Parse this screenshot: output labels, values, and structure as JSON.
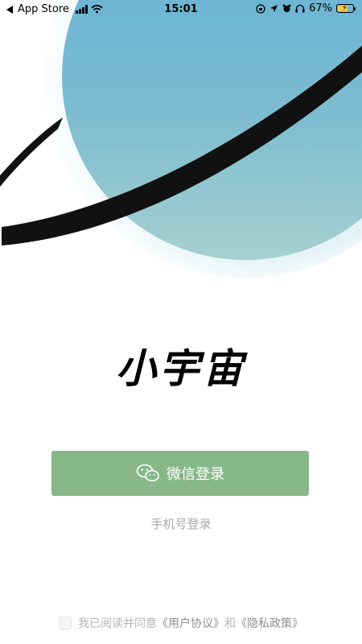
{
  "status_bar": {
    "back_app": "App Store",
    "time": "15:01",
    "battery_percent": "67%",
    "battery_level": 0.67,
    "icons": [
      "signal-icon",
      "wifi-icon",
      "screen-lock-icon",
      "location-icon",
      "alarm-icon",
      "headphones-icon",
      "battery-icon"
    ]
  },
  "hero": {
    "planet_color": "#6fb3d2",
    "ring_color": "#111111"
  },
  "app": {
    "title": "小宇宙"
  },
  "login": {
    "wechat_label": "微信登录",
    "wechat_icon": "wechat-icon",
    "button_color": "#88b88a",
    "phone_label": "手机号登录"
  },
  "agreement": {
    "prefix": "我已阅读并同意",
    "user_agreement": "《用户协议》",
    "conjunction": "和",
    "privacy_policy": "《隐私政策》",
    "checked": false
  }
}
